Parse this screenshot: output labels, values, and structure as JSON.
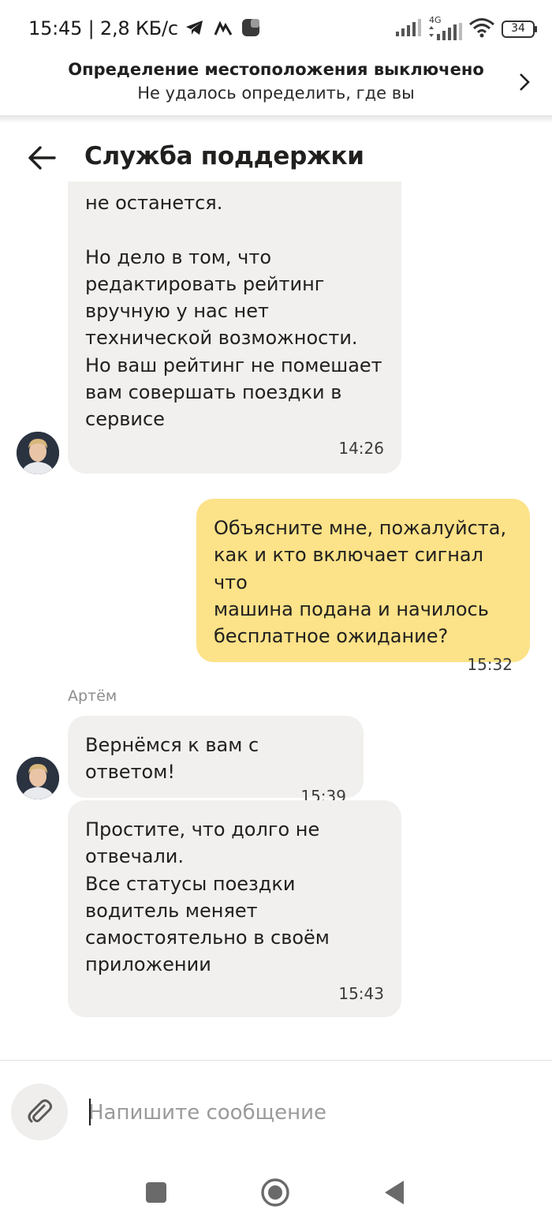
{
  "status_bar": {
    "time": "15:45",
    "speed": "2,8 КБ/с",
    "network": "4G",
    "battery": "34"
  },
  "location_banner": {
    "title": "Определение местоположения выключено",
    "subtitle": "Не удалось определить, где вы"
  },
  "header": {
    "title": "Служба поддержки"
  },
  "messages": [
    {
      "direction": "incoming",
      "text": "не останется.\n\nНо дело в том, что\nредактировать рейтинг\nвручную у нас нет\nтехнической возможности.\nНо ваш рейтинг не помешает\nвам совершать поездки в\nсервисе",
      "time": "14:26"
    },
    {
      "direction": "outgoing",
      "text": "Объясните мне, пожалуйста,\nкак и кто включает сигнал что\nмашина подана и начилось\nбесплатное ожидание?",
      "time": "15:32"
    },
    {
      "direction": "incoming",
      "sender": "Артём",
      "text": "Вернёмся к вам с ответом!",
      "time": "15:39"
    },
    {
      "direction": "incoming",
      "text": "Простите, что долго не\nотвечали.\nВсе статусы поездки\nводитель меняет\nсамостоятельно в своём\nприложении",
      "time": "15:43"
    }
  ],
  "composer": {
    "placeholder": "Напишите сообщение",
    "value": ""
  },
  "icons": {
    "back": "arrow-left-icon",
    "banner_chevron": "chevron-right-icon",
    "attach": "paperclip-icon",
    "nav_recents": "square-icon",
    "nav_home": "circle-icon",
    "nav_back": "triangle-back-icon"
  },
  "colors": {
    "incoming_bubble": "#f1f0ee",
    "outgoing_bubble": "#fce288",
    "text": "#21201f",
    "muted": "#8c8c8c"
  }
}
